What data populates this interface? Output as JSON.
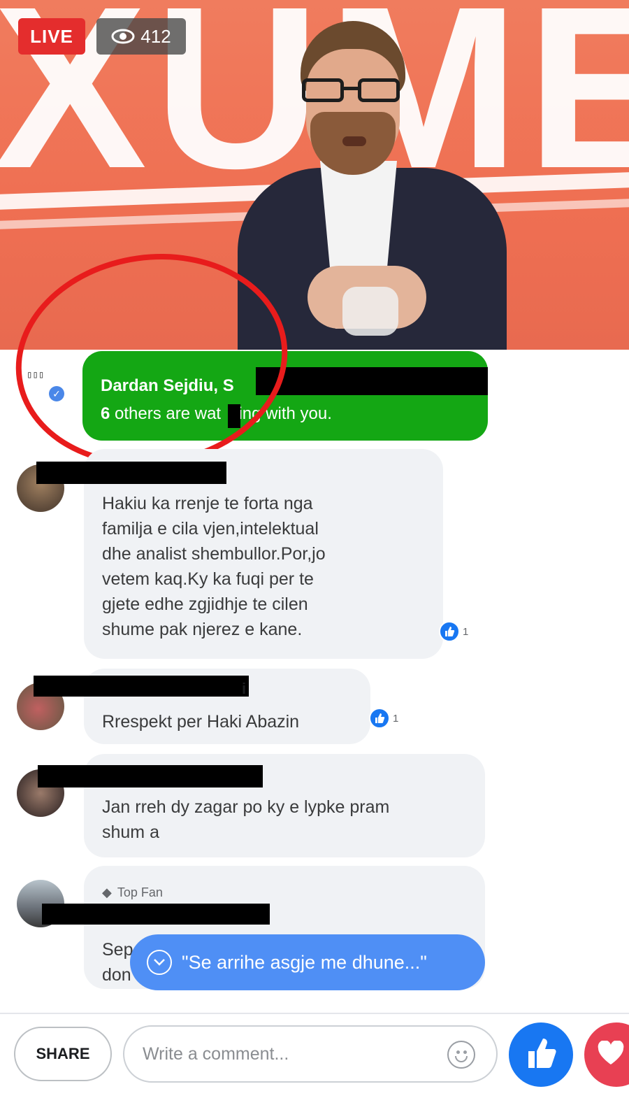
{
  "video": {
    "live_label": "LIVE",
    "viewer_count": "412",
    "background_letters": "XUME"
  },
  "watching": {
    "names": "Dardan Sejdiu, S",
    "count": "6",
    "message_rest": " others are wat",
    "message_end": "hing with you."
  },
  "comments": [
    {
      "text": "Hakiu ka rrenje te forta nga\nfamilja e cila vjen,intelektual\ndhe analist shembullor.Por,jo\nvetem kaq.Ky ka fuqi per te\ngjete edhe zgjidhje te cilen\nshume pak njerez e kane.",
      "likes": "1"
    },
    {
      "author_fragment": "i",
      "text": "Rrespekt per Haki Abazin",
      "likes": "1"
    },
    {
      "text": "Jan rreh dy zagar po ky e lypke pram\nshum a"
    },
    {
      "badge": "Top Fan",
      "text": "Sep\ndon"
    }
  ],
  "toast": {
    "text": "\"Se arrihe asgje me dhune...\""
  },
  "bottom_bar": {
    "share_label": "SHARE",
    "comment_placeholder": "Write a comment..."
  },
  "icons": {
    "viewers": "eye-icon",
    "verified": "verified-badge-icon",
    "reaction": "like-icon",
    "toast": "chevron-down-icon",
    "emoji": "emoji-icon",
    "like": "thumbs-up-icon",
    "love": "heart-icon"
  },
  "colors": {
    "live": "#e42d2d",
    "banner": "#14a714",
    "accent": "#1877f2",
    "toast": "#4f8ff5",
    "annotation": "#e81c1c"
  }
}
